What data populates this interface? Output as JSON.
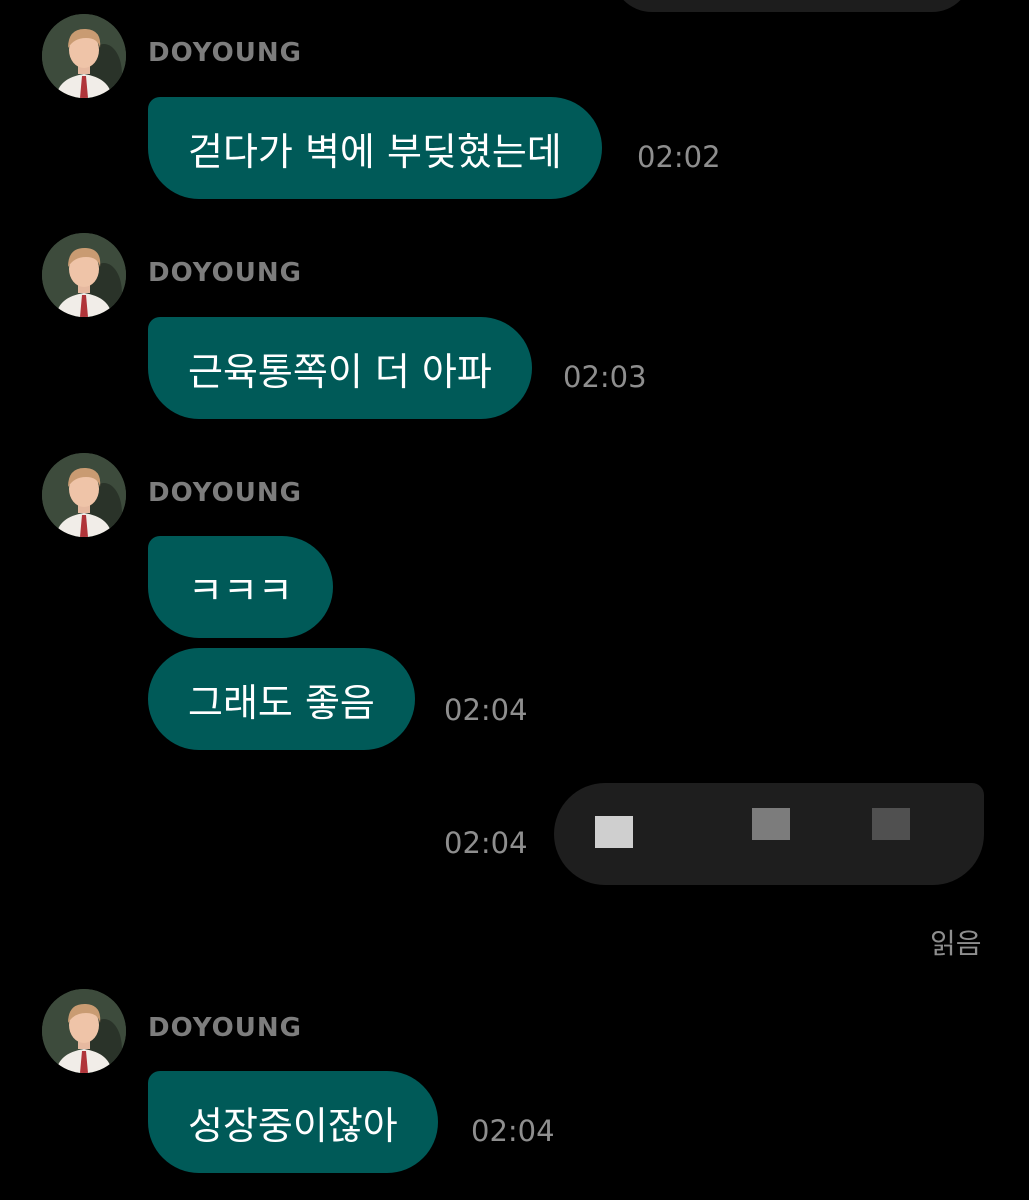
{
  "messages": [
    {
      "sender": "DOYOUNG",
      "text": "걷다가 벽에 부딪혔는데",
      "time": "02:02"
    },
    {
      "sender": "DOYOUNG",
      "text": "근육통쪽이 더 아파",
      "time": "02:03"
    },
    {
      "sender": "DOYOUNG",
      "text": "ㅋㅋㅋ"
    },
    {
      "text": "그래도 좋음",
      "time": "02:04"
    },
    {
      "text": "",
      "time": "02:04",
      "status": "읽음"
    },
    {
      "sender": "DOYOUNG",
      "text": "성장중이잖아",
      "time": "02:04"
    }
  ],
  "colors": {
    "background": "#000000",
    "incoming_bubble": "#005a58",
    "outgoing_bubble": "#1e1e1e",
    "meta_text": "#8e8e8e",
    "sender_text": "#7d7d7d"
  },
  "icons": {
    "avatar": "profile-avatar-illustration"
  }
}
